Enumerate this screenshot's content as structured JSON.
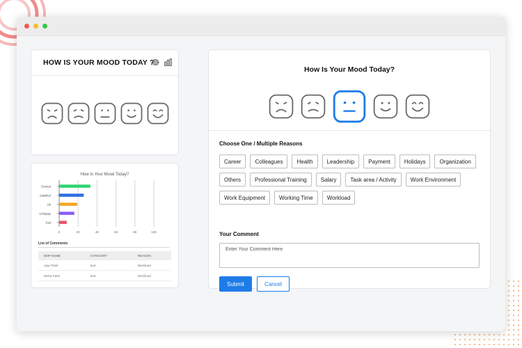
{
  "widget": {
    "title": "HOW IS YOUR MOOD TODAY ?",
    "icons": [
      "gear-icon",
      "bar-chart-icon"
    ],
    "moods": [
      "sad",
      "frown",
      "neutral",
      "smile",
      "happy"
    ]
  },
  "report": {
    "chart_title": "How Is Your Mood Today?",
    "list_title": "List of Comments",
    "table": {
      "headers": [
        "EMP NAME",
        "CATEGORY",
        "REASON"
      ],
      "rows": [
        [
          "Ajay Patel",
          "Sad",
          "Workload"
        ],
        [
          "Nisha Patel",
          "Sad",
          "Workload"
        ]
      ]
    }
  },
  "chart_data": {
    "type": "bar",
    "orientation": "horizontal",
    "title": "How Is Your Mood Today?",
    "categories": [
      "Excited",
      "Satisfied",
      "Ok",
      "Unhappy",
      "Sad"
    ],
    "values": [
      33,
      26,
      19,
      16,
      8
    ],
    "xlim": [
      0,
      100
    ],
    "xticks": [
      0,
      20,
      40,
      60,
      80,
      100
    ],
    "grid": true,
    "colors": [
      "#2ed573",
      "#2f6ee0",
      "#f5a623",
      "#8b5cf6",
      "#ef4d6a"
    ]
  },
  "form": {
    "title": "How Is Your Mood Today?",
    "moods": [
      {
        "name": "sad",
        "selected": false
      },
      {
        "name": "frown",
        "selected": false
      },
      {
        "name": "neutral",
        "selected": true
      },
      {
        "name": "smile",
        "selected": false
      },
      {
        "name": "happy",
        "selected": false
      }
    ],
    "reasons_label": "Choose One / Multiple Reasons",
    "reasons": [
      "Career",
      "Colleagues",
      "Health",
      "Leadership",
      "Payment",
      "Holidays",
      "Organization",
      "Others",
      "Professional Training",
      "Salary",
      "Task area / Activity",
      "Work Environment",
      "Work Equipment",
      "Working Time",
      "Workload"
    ],
    "comment_label": "Your Comment",
    "comment_placeholder": "Enter Your Comment Here",
    "submit_label": "Submit",
    "cancel_label": "Cancel"
  },
  "colors": {
    "accent": "#1e7ce8",
    "face_stroke": "#666666",
    "decor": "#f28b8b"
  }
}
